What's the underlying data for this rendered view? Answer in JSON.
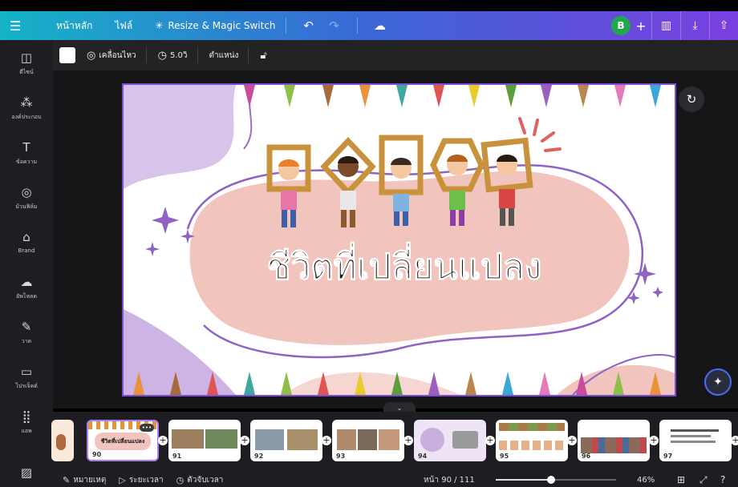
{
  "topbar": {
    "menu_icon": "menu-icon",
    "home_label": "หน้าหลัก",
    "file_label": "ไฟล์",
    "resize_label": "Resize & Magic Switch",
    "resize_icon": "sparkle-icon",
    "undo_icon": "undo-icon",
    "redo_icon": "redo-icon",
    "cloud_icon": "cloud-check-icon",
    "avatar_letter": "B",
    "add_icon": "plus-icon",
    "chart_icon": "chart-icon",
    "download_icon": "download-icon",
    "share_icon": "share-icon"
  },
  "sidebar": {
    "items": [
      {
        "label": "ดีไซน์",
        "icon": "design-icon",
        "glyph": "◫"
      },
      {
        "label": "องค์ประกอบ",
        "icon": "elements-icon",
        "glyph": "⁂"
      },
      {
        "label": "ข้อความ",
        "icon": "text-icon",
        "glyph": "T"
      },
      {
        "label": "ม้วนฟิล์ม",
        "icon": "camera-icon",
        "glyph": "◎"
      },
      {
        "label": "Brand",
        "icon": "brand-icon",
        "glyph": "⌂"
      },
      {
        "label": "อัพโหลด",
        "icon": "upload-icon",
        "glyph": "☁"
      },
      {
        "label": "วาด",
        "icon": "draw-icon",
        "glyph": "✎"
      },
      {
        "label": "โปรเจ็คต์",
        "icon": "folder-icon",
        "glyph": "▭"
      },
      {
        "label": "แอพ",
        "icon": "apps-icon",
        "glyph": "⣿"
      },
      {
        "label": "",
        "icon": "photo-icon",
        "glyph": "▨"
      }
    ]
  },
  "toolbar": {
    "animate_label": "เคลื่อนไหว",
    "duration_label": "5.0วิ",
    "position_label": "ตำแหน่ง",
    "swatch_color": "#ffffff"
  },
  "slide": {
    "title": "ชีวิตที่เปลี่ยนแปลง"
  },
  "strip": {
    "thumbnails": [
      {
        "num": "",
        "selected": false
      },
      {
        "num": "90",
        "selected": true,
        "text": "ชีวิตที่เปลี่ยนแปลง"
      },
      {
        "num": "91",
        "selected": false
      },
      {
        "num": "92",
        "selected": false
      },
      {
        "num": "93",
        "selected": false
      },
      {
        "num": "94",
        "selected": false
      },
      {
        "num": "95",
        "selected": false
      },
      {
        "num": "96",
        "selected": false
      },
      {
        "num": "97",
        "selected": false
      }
    ]
  },
  "bottombar": {
    "notes_label": "หมายเหตุ",
    "timing_label": "ระยะเวลา",
    "timer_label": "ตัวจับเวลา",
    "page_label": "หน้า 90 / 111",
    "zoom_label": "46%",
    "zoom_value": 0.46
  },
  "colors": {
    "accent": "#7d4dd8",
    "pink": "#f2c4be",
    "lavender": "#c9aee0"
  }
}
